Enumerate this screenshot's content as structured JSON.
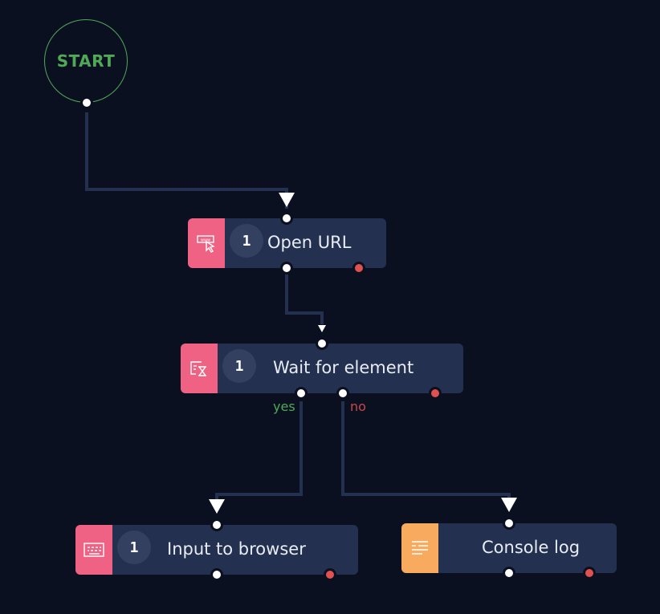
{
  "canvas": {
    "background": "#0b1020",
    "wire_color": "#24304f"
  },
  "start": {
    "label": "START",
    "color": "#4fa957"
  },
  "nodes": [
    {
      "id": "open-url",
      "label": "Open URL",
      "badge": "1",
      "icon": "www-cursor-icon",
      "accent": "#f06283"
    },
    {
      "id": "wait-for-element",
      "label": "Wait for element",
      "badge": "1",
      "icon": "element-hourglass-icon",
      "accent": "#f06283",
      "branches": {
        "yes": "yes",
        "no": "no"
      }
    },
    {
      "id": "input-to-browser",
      "label": "Input to browser",
      "badge": "1",
      "icon": "keyboard-icon",
      "accent": "#f06283"
    },
    {
      "id": "console-log",
      "label": "Console log",
      "badge": "",
      "icon": "text-lines-icon",
      "accent": "#f8ab5e"
    }
  ],
  "colors": {
    "success": "#4fa957",
    "error": "#e0514f",
    "port": "#ffffff",
    "node_bg": "#24304f",
    "badge_bg": "#34405f"
  }
}
